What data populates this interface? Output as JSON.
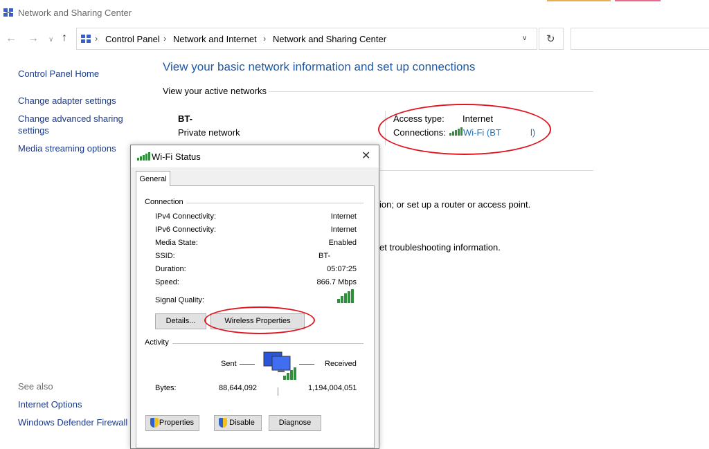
{
  "window": {
    "title": "Network and Sharing Center"
  },
  "breadcrumb": [
    "Control Panel",
    "Network and Internet",
    "Network and Sharing Center"
  ],
  "left_pane": {
    "links": [
      "Control Panel Home",
      "Change adapter settings",
      "Change advanced sharing settings",
      "Media streaming options"
    ],
    "see_also_label": "See also",
    "see_also": [
      "Internet Options",
      "Windows Defender Firewall"
    ]
  },
  "main": {
    "heading": "View your basic network information and set up connections",
    "active_networks_label": "View your active networks",
    "network_name": "BT-",
    "network_type": "Private network",
    "access_type_label": "Access type:",
    "access_type_value": "Internet",
    "connections_label": "Connections:",
    "connection_link": "Wi-Fi (BT",
    "connection_link_end": "l)",
    "frag1": "ion; or set up a router or access point.",
    "frag2": "et troubleshooting information."
  },
  "dialog": {
    "title": "Wi-Fi Status",
    "tab": "General",
    "connection_group": "Connection",
    "rows": [
      {
        "label": "IPv4 Connectivity:",
        "value": "Internet"
      },
      {
        "label": "IPv6 Connectivity:",
        "value": "Internet"
      },
      {
        "label": "Media State:",
        "value": "Enabled"
      },
      {
        "label": "SSID:",
        "value": "BT-"
      },
      {
        "label": "Duration:",
        "value": "05:07:25"
      },
      {
        "label": "Speed:",
        "value": "866.7 Mbps"
      }
    ],
    "signal_label": "Signal Quality:",
    "details_button": "Details...",
    "wireless_button": "Wireless Properties",
    "activity_group": "Activity",
    "sent_label": "Sent",
    "received_label": "Received",
    "bytes_label": "Bytes:",
    "bytes_sent": "88,644,092",
    "bytes_received": "1,194,004,051",
    "properties_button": "Properties",
    "disable_button": "Disable",
    "diagnose_button": "Diagnose"
  },
  "colors": {
    "link": "#1e73be",
    "heading": "#1e5aa8",
    "annotation": "#e0141e",
    "signal": "#2f8f3a"
  }
}
